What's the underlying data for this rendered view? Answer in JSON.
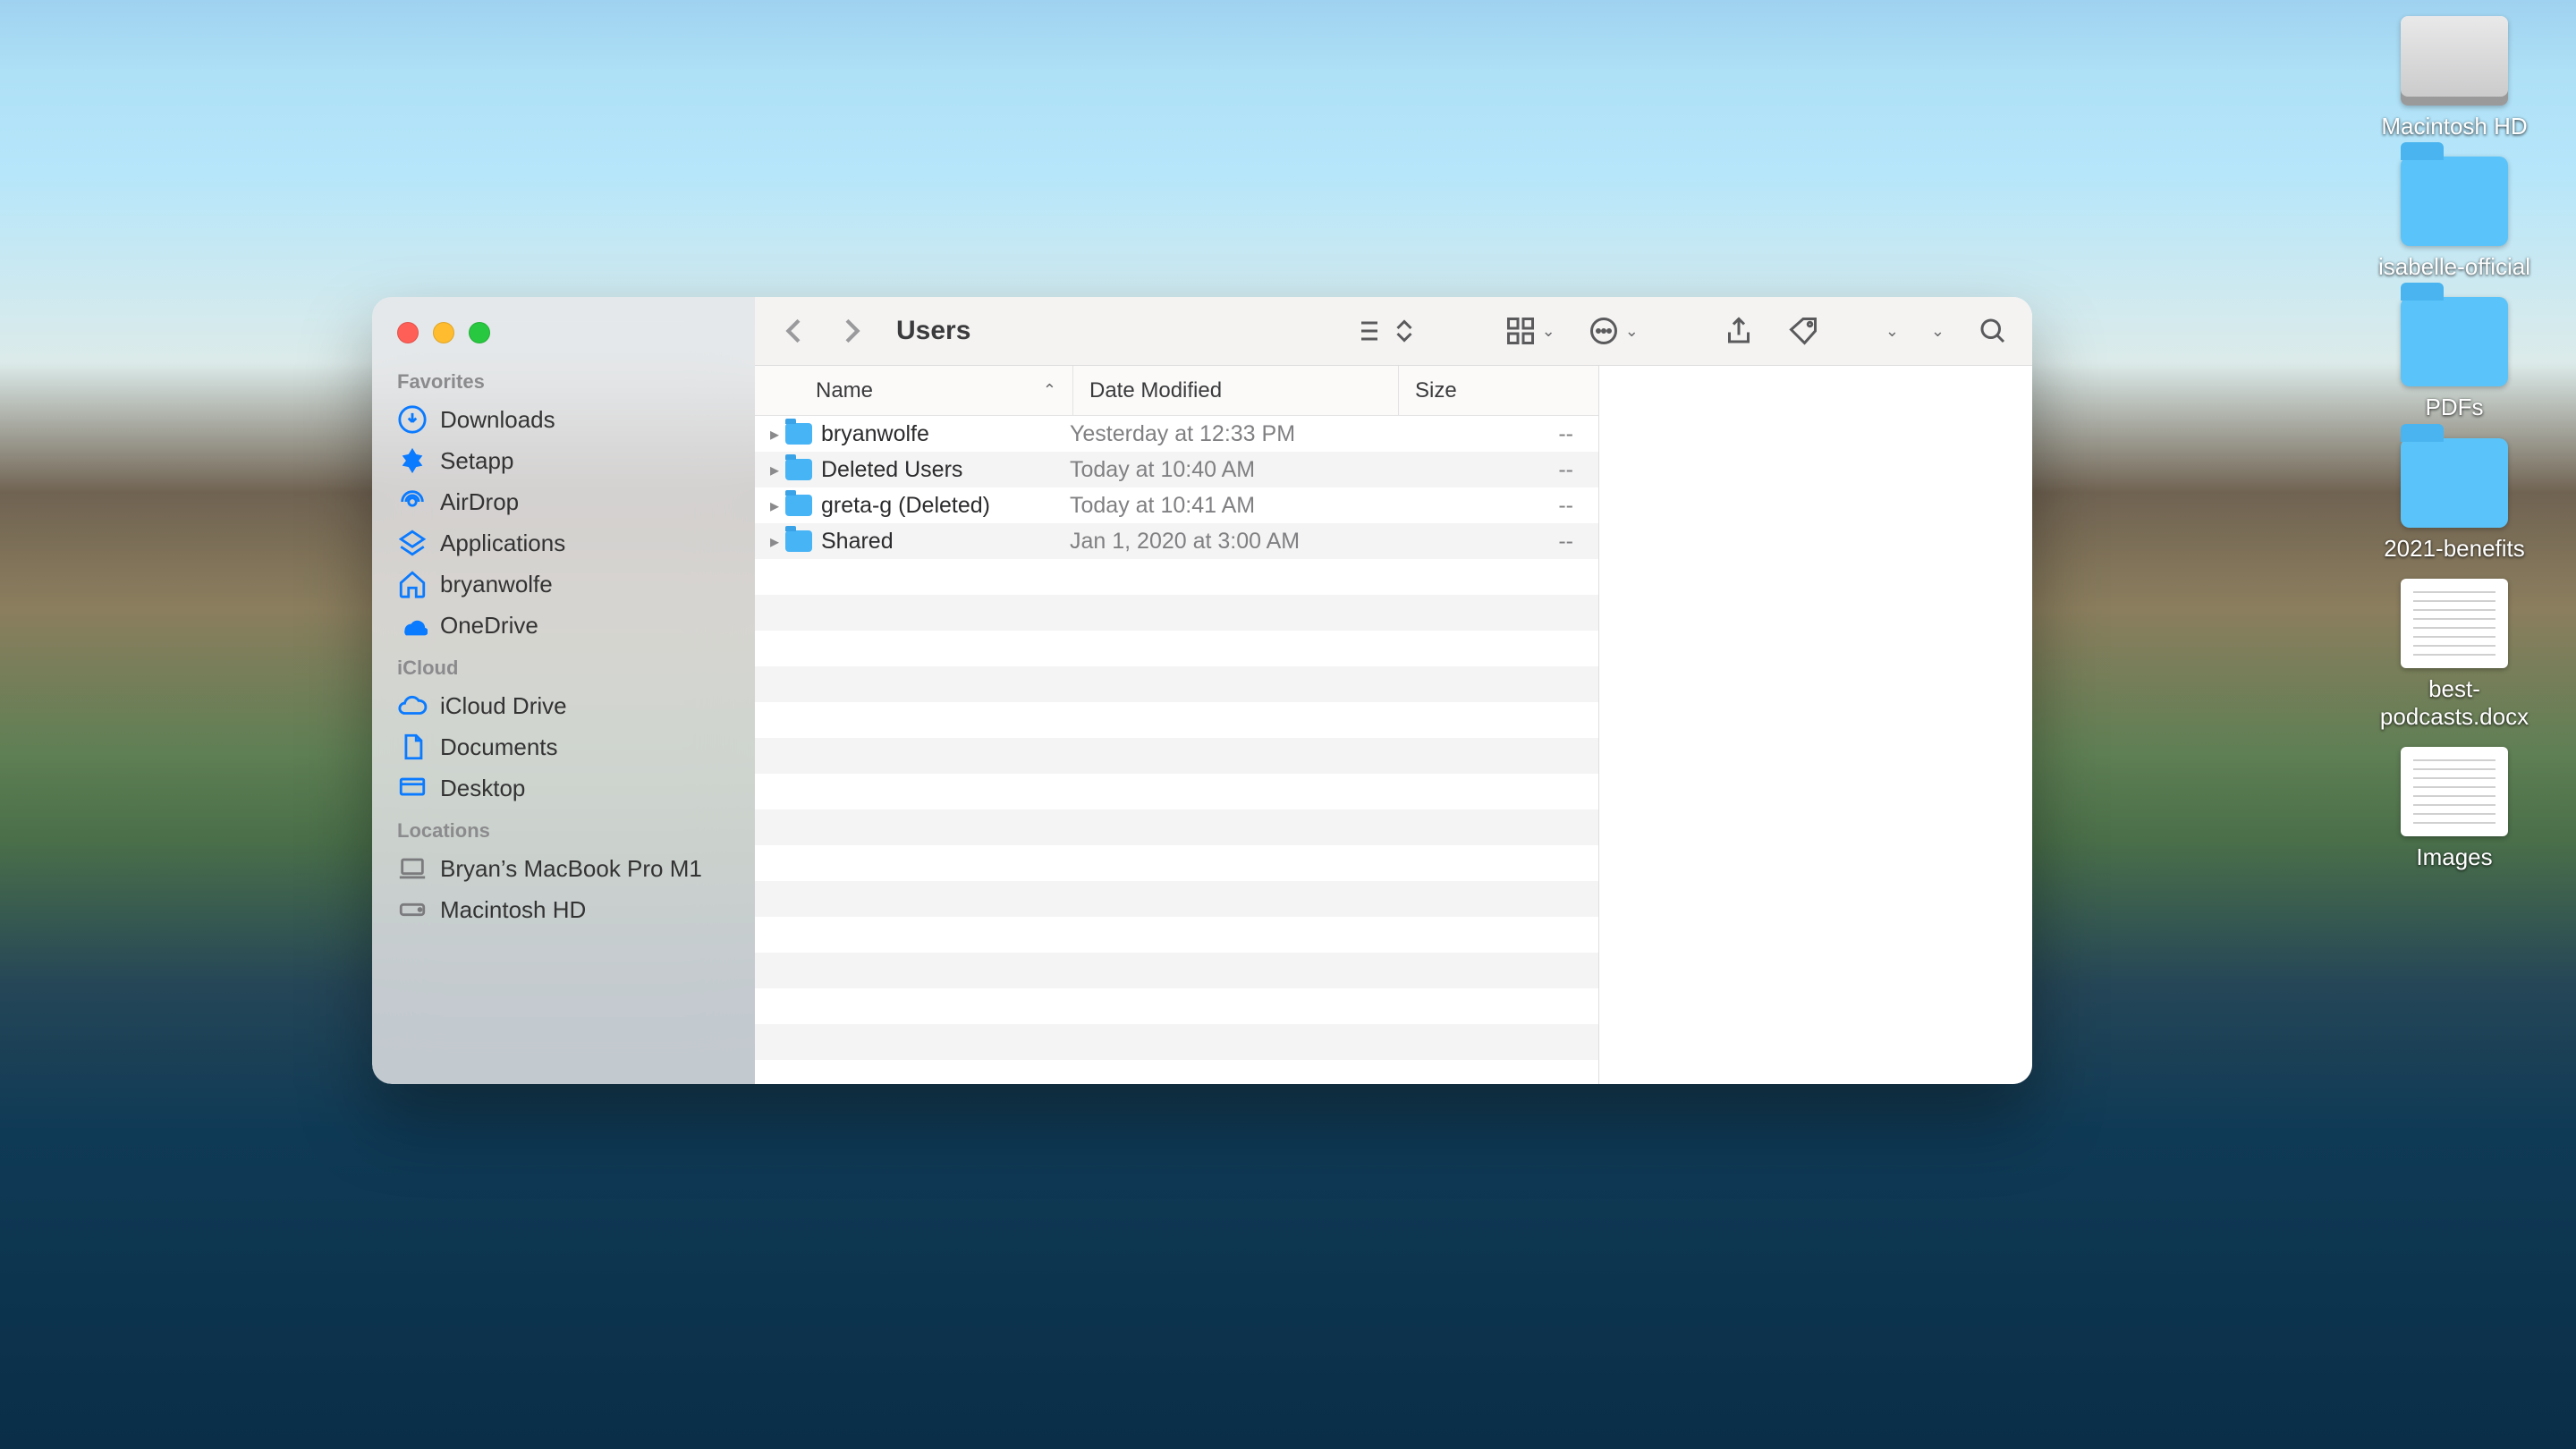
{
  "desktop_icons": [
    {
      "kind": "disk",
      "label": "Macintosh HD"
    },
    {
      "kind": "folder",
      "label": "isabelle-official"
    },
    {
      "kind": "folder",
      "label": "PDFs"
    },
    {
      "kind": "folder",
      "label": "2021-benefits"
    },
    {
      "kind": "doc",
      "label": "best-\npodcasts.docx"
    },
    {
      "kind": "images",
      "label": "Images"
    }
  ],
  "finder": {
    "title": "Users",
    "sidebar": {
      "sections": [
        {
          "label": "Favorites",
          "items": [
            {
              "icon": "download-icon",
              "label": "Downloads"
            },
            {
              "icon": "setapp-icon",
              "label": "Setapp"
            },
            {
              "icon": "airdrop-icon",
              "label": "AirDrop"
            },
            {
              "icon": "apps-icon",
              "label": "Applications"
            },
            {
              "icon": "home-icon",
              "label": "bryanwolfe"
            },
            {
              "icon": "onedrive-icon",
              "label": "OneDrive"
            }
          ]
        },
        {
          "label": "iCloud",
          "items": [
            {
              "icon": "cloud-icon",
              "label": "iCloud Drive"
            },
            {
              "icon": "document-icon",
              "label": "Documents"
            },
            {
              "icon": "desktop-icon",
              "label": "Desktop"
            }
          ]
        },
        {
          "label": "Locations",
          "items": [
            {
              "icon": "laptop-icon",
              "label": "Bryan’s MacBook Pro M1",
              "grey": true
            },
            {
              "icon": "disk-icon",
              "label": "Macintosh HD",
              "grey": true
            }
          ]
        }
      ]
    },
    "columns": {
      "name": "Name",
      "date": "Date Modified",
      "size": "Size"
    },
    "rows": [
      {
        "name": "bryanwolfe",
        "date": "Yesterday at 12:33 PM",
        "size": "--"
      },
      {
        "name": "Deleted Users",
        "date": "Today at 10:40 AM",
        "size": "--"
      },
      {
        "name": "greta-g (Deleted)",
        "date": "Today at 10:41 AM",
        "size": "--"
      },
      {
        "name": "Shared",
        "date": "Jan 1, 2020 at 3:00 AM",
        "size": "--"
      }
    ]
  }
}
